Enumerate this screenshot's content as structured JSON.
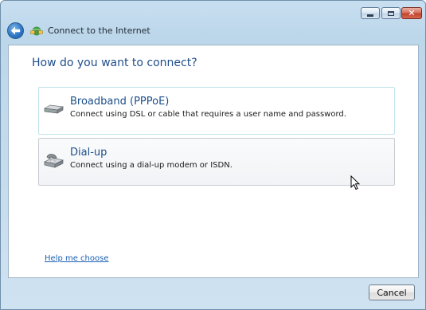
{
  "window": {
    "caption_buttons": {
      "minimize": "minimize",
      "maximize": "maximize",
      "close": "✕"
    }
  },
  "header": {
    "title": "Connect to the Internet",
    "back_icon": "back-arrow-icon",
    "wizard_icon": "network-globe-icon"
  },
  "main": {
    "heading": "How do you want to connect?",
    "options": [
      {
        "title": "Broadband (PPPoE)",
        "description": "Connect using DSL or cable that requires a user name and password.",
        "icon": "broadband-modem-icon"
      },
      {
        "title": "Dial-up",
        "description": "Connect using a dial-up modem or ISDN.",
        "icon": "dialup-phone-icon"
      }
    ],
    "help_link": "Help me choose"
  },
  "footer": {
    "cancel_label": "Cancel"
  },
  "colors": {
    "heading_blue": "#1f4d8c",
    "link_blue": "#1b5fb2",
    "close_red": "#c2442d",
    "frame_blue": "#bcd6ea"
  }
}
